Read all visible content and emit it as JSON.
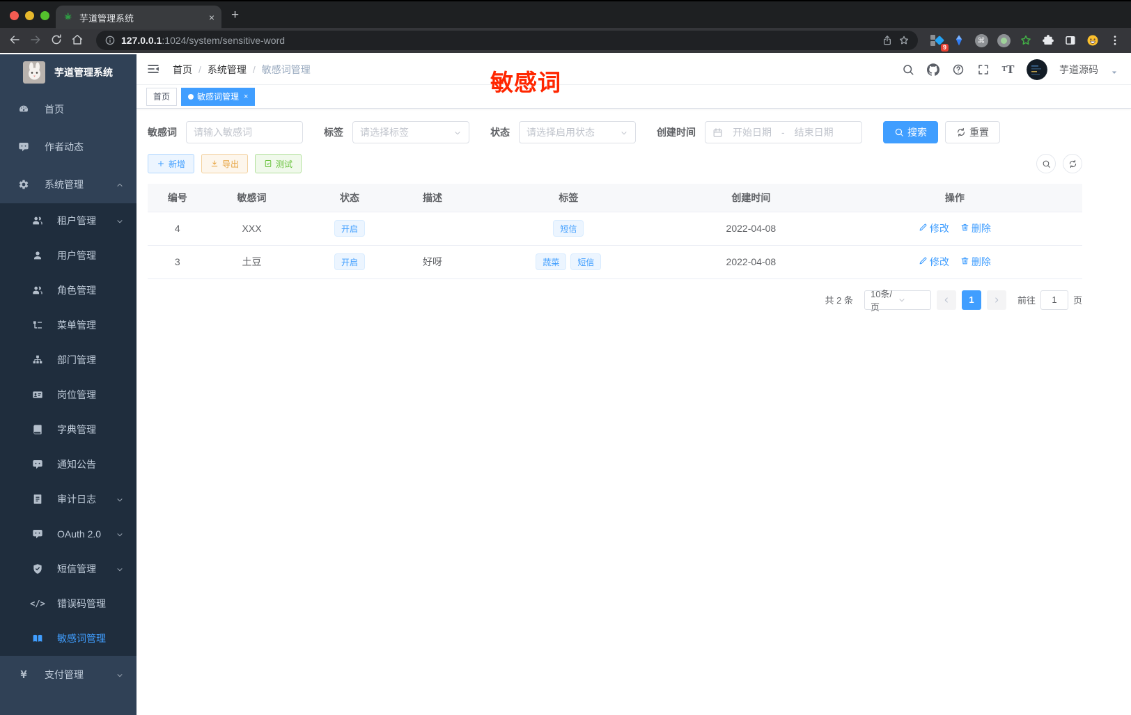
{
  "browser": {
    "tab_title": "芋道管理系统",
    "tab_close": "×",
    "new_tab": "+",
    "url_host": "127.0.0.1",
    "url_path": ":1024/system/sensitive-word",
    "extension_badge": "9",
    "cmd_glyph": "⌘"
  },
  "sidebar": {
    "title": "芋道管理系统",
    "items": [
      {
        "key": "home",
        "label": "首页",
        "icon": "dashboard",
        "level": 1
      },
      {
        "key": "author-news",
        "label": "作者动态",
        "icon": "chat",
        "level": 1
      },
      {
        "key": "system",
        "label": "系统管理",
        "icon": "gear",
        "level": 1,
        "arrow": "up"
      },
      {
        "key": "tenant",
        "label": "租户管理",
        "icon": "users",
        "level": 2,
        "arrow": "down"
      },
      {
        "key": "user",
        "label": "用户管理",
        "icon": "user",
        "level": 2
      },
      {
        "key": "role",
        "label": "角色管理",
        "icon": "users",
        "level": 2
      },
      {
        "key": "menu",
        "label": "菜单管理",
        "icon": "tree",
        "level": 2
      },
      {
        "key": "dept",
        "label": "部门管理",
        "icon": "org",
        "level": 2
      },
      {
        "key": "post",
        "label": "岗位管理",
        "icon": "badge",
        "level": 2
      },
      {
        "key": "dict",
        "label": "字典管理",
        "icon": "book",
        "level": 2
      },
      {
        "key": "notice",
        "label": "通知公告",
        "icon": "chat",
        "level": 2
      },
      {
        "key": "audit-log",
        "label": "审计日志",
        "icon": "log",
        "level": 2,
        "arrow": "down"
      },
      {
        "key": "oauth",
        "label": "OAuth 2.0",
        "icon": "chat",
        "level": 2,
        "arrow": "down"
      },
      {
        "key": "sms",
        "label": "短信管理",
        "icon": "shield",
        "level": 2,
        "arrow": "down"
      },
      {
        "key": "error-code",
        "label": "错误码管理",
        "icon": "code",
        "level": 2
      },
      {
        "key": "sensitive-word",
        "label": "敏感词管理",
        "icon": "openbook",
        "level": 2,
        "active": true
      },
      {
        "key": "pay",
        "label": "支付管理",
        "icon": "yen",
        "level": 1,
        "arrow": "down"
      }
    ]
  },
  "navbar": {
    "breadcrumb": [
      "首页",
      "系统管理",
      "敏感词管理"
    ],
    "username": "芋道源码"
  },
  "watermark": "敏感词",
  "tags": [
    {
      "label": "首页",
      "active": false
    },
    {
      "label": "敏感词管理",
      "active": true,
      "closable": true
    }
  ],
  "filters": {
    "keyword_label": "敏感词",
    "keyword_placeholder": "请输入敏感词",
    "tag_label": "标签",
    "tag_placeholder": "请选择标签",
    "status_label": "状态",
    "status_placeholder": "请选择启用状态",
    "date_label": "创建时间",
    "date_start_placeholder": "开始日期",
    "date_separator": "-",
    "date_end_placeholder": "结束日期",
    "search_label": "搜索",
    "reset_label": "重置"
  },
  "actions": {
    "add": "新增",
    "export": "导出",
    "test": "测试"
  },
  "table": {
    "columns": [
      "编号",
      "敏感词",
      "状态",
      "描述",
      "标签",
      "创建时间",
      "操作"
    ],
    "rows": [
      {
        "id": "4",
        "word": "XXX",
        "status": "开启",
        "desc": "",
        "tags": [
          "短信"
        ],
        "created": "2022-04-08"
      },
      {
        "id": "3",
        "word": "土豆",
        "status": "开启",
        "desc": "好呀",
        "tags": [
          "蔬菜",
          "短信"
        ],
        "created": "2022-04-08"
      }
    ],
    "edit_label": "修改",
    "delete_label": "删除"
  },
  "pagination": {
    "total": "共 2 条",
    "page_size": "10条/页",
    "current_page": "1",
    "goto_label": "前往",
    "goto_value": "1",
    "page_unit": "页"
  },
  "colors": {
    "primary": "#409eff",
    "warning": "#e6a23c",
    "success": "#67c23a",
    "sidebar_bg": "#304156",
    "submenu_bg": "#1f2d3d",
    "watermark_red": "#ff2600"
  }
}
